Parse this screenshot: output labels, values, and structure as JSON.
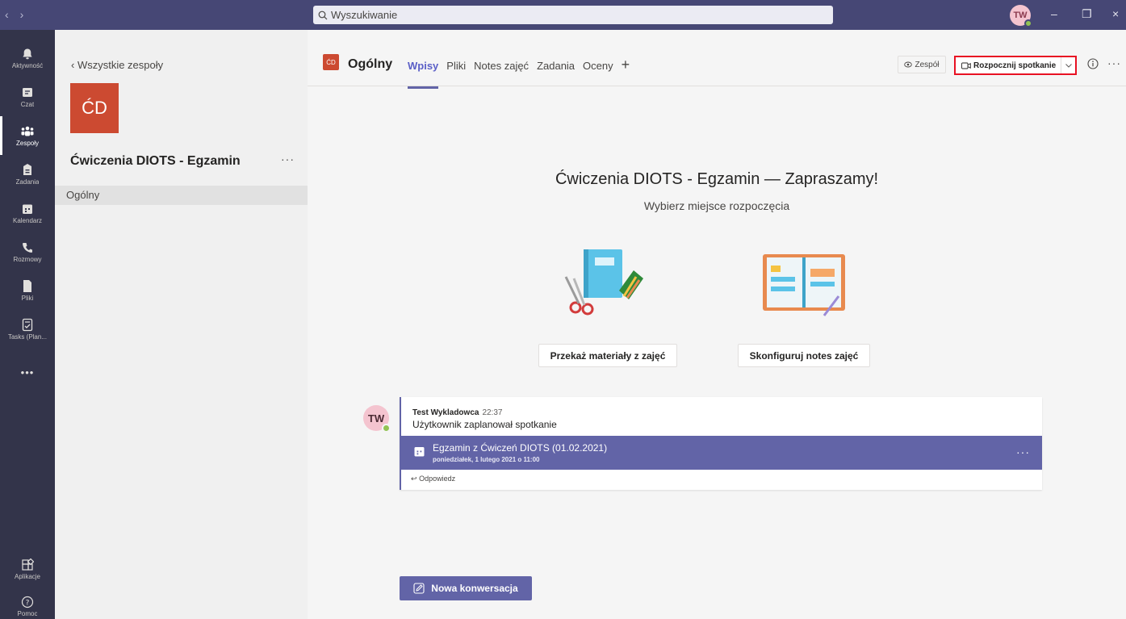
{
  "titlebar": {
    "back_arrow": "‹",
    "forward_arrow": "›",
    "search_placeholder": "Wyszukiwanie",
    "avatar_initials": "TW",
    "minimize": "–",
    "maximize": "❐",
    "close": "×"
  },
  "rail": {
    "items": [
      {
        "label": "Aktywność",
        "icon": "bell-icon"
      },
      {
        "label": "Czat",
        "icon": "chat-icon"
      },
      {
        "label": "Zespoły",
        "icon": "teams-icon"
      },
      {
        "label": "Zadania",
        "icon": "assignments-icon"
      },
      {
        "label": "Kalendarz",
        "icon": "calendar-icon"
      },
      {
        "label": "Rozmowy",
        "icon": "phone-icon"
      },
      {
        "label": "Pliki",
        "icon": "file-icon"
      },
      {
        "label": "Tasks (Plan...",
        "icon": "tasks-icon"
      }
    ],
    "more": "•••",
    "apps_label": "Aplikacje",
    "help_label": "Pomoc"
  },
  "leftpanel": {
    "back_label": "‹  Wszystkie zespoły",
    "team_tile": "ĆD",
    "team_name": "Ćwiczenia DIOTS - Egzamin",
    "team_more": "···",
    "channel": "Ogólny"
  },
  "header": {
    "channel_tile": "ĆD",
    "channel_name": "Ogólny",
    "tabs": [
      "Wpisy",
      "Pliki",
      "Notes zajęć",
      "Zadania",
      "Oceny"
    ],
    "add_tab": "+",
    "team_button": "Zespół",
    "meet_button": "Rozpocznij spotkanie",
    "more": "···"
  },
  "welcome": {
    "title": "Ćwiczenia DIOTS - Egzamin — Zapraszamy!",
    "subtitle": "Wybierz miejsce rozpoczęcia",
    "button1": "Przekaż materiały z zajęć",
    "button2": "Skonfiguruj notes zajęć"
  },
  "post": {
    "avatar": "TW",
    "author": "Test Wykladowca",
    "time": "22:37",
    "text": "Użytkownik zaplanował spotkanie",
    "meeting_title": "Egzamin z Ćwiczeń DIOTS (01.02.2021)",
    "meeting_date": "poniedziałek, 1 lutego 2021 o 11:00",
    "meeting_more": "···",
    "reply": "Odpowiedz"
  },
  "new_conversation": "Nowa konwersacja",
  "colors": {
    "titlebar": "#464775",
    "rail": "#33344a",
    "accent": "#6264a7",
    "team_tile": "#cc4a31",
    "highlight_border": "#e81123"
  }
}
